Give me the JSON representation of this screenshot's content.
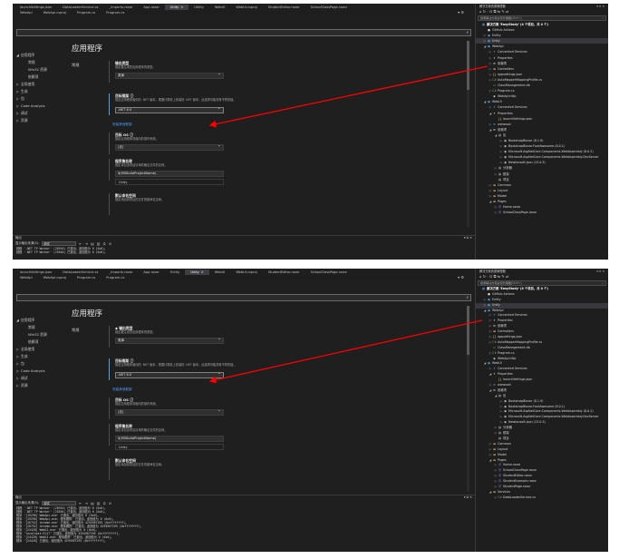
{
  "accent_color": "#ff0000",
  "highlight_color": "#56a0e8",
  "screens": [
    {
      "tabs_row1": [
        {
          "label": "launchSettings.json",
          "active": false
        },
        {
          "label": "DataLoaderService.cs",
          "active": false
        },
        {
          "label": "_Imports.razor",
          "active": false
        },
        {
          "label": "App.razor",
          "active": false
        },
        {
          "label": "Unity",
          "active": true,
          "close": "✕"
        },
        {
          "label": "Utility",
          "active": false
        },
        {
          "label": "WebUI",
          "active": false
        },
        {
          "label": "WebUI.csproj",
          "active": false
        },
        {
          "label": "StudentEditor.razor",
          "active": false
        },
        {
          "label": "SchoolClassPage.razor",
          "active": false
        }
      ],
      "tabs_row2": [
        {
          "label": "WebApi",
          "active": false
        },
        {
          "label": "WebApi.csproj",
          "active": false
        },
        {
          "label": "Program.cs",
          "active": false
        },
        {
          "label": "Program.cs",
          "active": false
        }
      ],
      "tab_controls": "▾ ⚙",
      "search": {
        "placeholder": "",
        "icon": "⌕"
      },
      "nav": [
        {
          "label": "应用程序",
          "caret": "◢",
          "sub": false
        },
        {
          "label": "常规",
          "caret": "",
          "sub": true
        },
        {
          "label": "Win32 资源",
          "caret": "",
          "sub": true
        },
        {
          "label": "依赖项",
          "caret": "",
          "sub": true
        },
        {
          "label": "全局使用",
          "caret": "▷",
          "sub": false
        },
        {
          "label": "生成",
          "caret": "▷",
          "sub": false
        },
        {
          "label": "包",
          "caret": "▷",
          "sub": false
        },
        {
          "label": "Code Analysis",
          "caret": "▷",
          "sub": false
        },
        {
          "label": "调试",
          "caret": "▷",
          "sub": false
        },
        {
          "label": "资源",
          "caret": "▷",
          "sub": false
        }
      ],
      "page_title": "应用程序",
      "section_title": "常规",
      "fields": {
        "output_type_label": "输出类型",
        "output_type_desc": "指定要生成的应用程序的类型。",
        "output_type_value": "类库",
        "target_fw_label": "目标框架 ⓘ",
        "target_fw_desc": "指定应用程序面向的 .NET 版本。根据计算机上安装的 .NET 版本，此选项可能具有不同的值。",
        "target_fw_value": ".NET 6.0",
        "install_link": "安装其他框架",
        "target_os_label": "目标 OS ⓘ",
        "target_os_desc": "指定应用程序将面向的操作系统。",
        "target_os_value": "(无)",
        "assembly_label": "程序集名称",
        "assembly_desc": "指定将包含项目清单的输出文件的名称。",
        "assembly_value": "$(MSBuildProjectName)",
        "assembly_resolved": "Unity",
        "namespace_label": "默认命名空间",
        "namespace_desc": "指定添加到项目的文件的基命名空间。"
      },
      "output": {
        "title": "输出",
        "controls": "▾ ⧉ ✕",
        "show_from": "显示输出来源(S):",
        "source": "调试",
        "toolbar_icons": [
          "⇤",
          "⇥",
          "▤",
          "▥",
          "⛭",
          "⊘"
        ],
        "lines": [
          "线程 '.NET TP Worker' (26916) 已退出，返回值为 0 (0x0)。",
          "线程 '.NET TP Worker' (25564) 已退出，返回值为 0 (0x0)。"
        ]
      },
      "solution": {
        "title": "解决方案资源管理器",
        "controls": "▾ ⊓ ✕",
        "toolbar": "⌂ ↻ · ⊡ ⧉ ⇆ ✎ ⇌",
        "search_placeholder": "搜索解决方案资源管理器(Ctrl+;)",
        "search_icon": "⌕",
        "rows": [
          {
            "d": 0,
            "tw": "",
            "ic": "▦",
            "k": "proj",
            "t": "解决方案 'EasyStudy' (4 个项目，共 4 个)",
            "bold": true
          },
          {
            "d": 1,
            "tw": "",
            "ic": "●",
            "k": "gh",
            "t": "GitHub Actions"
          },
          {
            "d": 1,
            "tw": "▷",
            "ic": "▣",
            "k": "proj",
            "t": "Entity"
          },
          {
            "d": 1,
            "tw": "▷",
            "ic": "▣",
            "k": "proj",
            "t": "Unity",
            "sel": true
          },
          {
            "d": 1,
            "tw": "◢",
            "ic": "▣",
            "k": "proj",
            "t": "WebApi"
          },
          {
            "d": 2,
            "tw": "▷",
            "ic": "✦",
            "k": "conn",
            "t": "Connected Services"
          },
          {
            "d": 2,
            "tw": "▷",
            "ic": "✦",
            "k": "file",
            "t": "Properties"
          },
          {
            "d": 2,
            "tw": "▷",
            "ic": "⊞",
            "k": "pkg",
            "t": "依赖项"
          },
          {
            "d": 2,
            "tw": "▷",
            "ic": "▬",
            "k": "fold",
            "t": "Controllers"
          },
          {
            "d": 2,
            "tw": "▷",
            "ic": "{}",
            "k": "json",
            "t": "appsettings.json"
          },
          {
            "d": 2,
            "tw": "▷",
            "ic": "C#",
            "k": "cs",
            "t": "AutoMapperMappingProfile.cs"
          },
          {
            "d": 2,
            "tw": "",
            "ic": "▭",
            "k": "file",
            "t": "ClassManagement.db"
          },
          {
            "d": 2,
            "tw": "▷",
            "ic": "C#",
            "k": "cs",
            "t": "Program.cs"
          },
          {
            "d": 2,
            "tw": "",
            "ic": "◆",
            "k": "file",
            "t": "WebApi.http"
          },
          {
            "d": 1,
            "tw": "◢",
            "ic": "▣",
            "k": "proj",
            "t": "WebUI"
          },
          {
            "d": 2,
            "tw": "▷",
            "ic": "✦",
            "k": "conn",
            "t": "Connected Services"
          },
          {
            "d": 2,
            "tw": "◢",
            "ic": "✦",
            "k": "file",
            "t": "Properties"
          },
          {
            "d": 3,
            "tw": "",
            "ic": "{}",
            "k": "json",
            "t": "launchSettings.json"
          },
          {
            "d": 2,
            "tw": "▷",
            "ic": "⊕",
            "k": "proj",
            "t": "wwwroot"
          },
          {
            "d": 2,
            "tw": "◢",
            "ic": "⊞",
            "k": "pkg",
            "t": "依赖项"
          },
          {
            "d": 3,
            "tw": "◢",
            "ic": "▤",
            "k": "pkg",
            "t": "包"
          },
          {
            "d": 4,
            "tw": "▷",
            "ic": "◉",
            "k": "pkg",
            "t": "BootstrapBlazor (8.1.9)"
          },
          {
            "d": 4,
            "tw": "▷",
            "ic": "◉",
            "k": "pkg",
            "t": "BootstrapBlazor.FontAwesome (8.0.1)"
          },
          {
            "d": 4,
            "tw": "▷",
            "ic": "◉",
            "k": "pkg",
            "t": "Microsoft.AspNetCore.Components.WebAssembly (8.0.2)"
          },
          {
            "d": 4,
            "tw": "▷",
            "ic": "◉",
            "k": "pkg",
            "t": "Microsoft.AspNetCore.Components.WebAssembly.DevServer"
          },
          {
            "d": 4,
            "tw": "▷",
            "ic": "◉",
            "k": "pkg",
            "t": "Newtonsoft.Json (13.0.3)"
          },
          {
            "d": 3,
            "tw": "▷",
            "ic": "▤",
            "k": "pkg",
            "t": "分析器"
          },
          {
            "d": 3,
            "tw": "▷",
            "ic": "▤",
            "k": "pkg",
            "t": "框架"
          },
          {
            "d": 3,
            "tw": "",
            "ic": "▤",
            "k": "pkg",
            "t": "项目"
          },
          {
            "d": 2,
            "tw": "▷",
            "ic": "▬",
            "k": "fold",
            "t": "Common"
          },
          {
            "d": 2,
            "tw": "▷",
            "ic": "▬",
            "k": "fold",
            "t": "Layout"
          },
          {
            "d": 2,
            "tw": "▷",
            "ic": "▬",
            "k": "fold",
            "t": "Model"
          },
          {
            "d": 2,
            "tw": "◢",
            "ic": "▬",
            "k": "fold",
            "t": "Pages"
          },
          {
            "d": 3,
            "tw": "▷",
            "ic": "@",
            "k": "razor",
            "t": "Home.razor"
          },
          {
            "d": 3,
            "tw": "▷",
            "ic": "@",
            "k": "razor",
            "t": "SchoolClassPage.razor"
          }
        ]
      }
    },
    {
      "tabs_row1": [
        {
          "label": "launchSettings.json",
          "active": false
        },
        {
          "label": "DataLoaderService.cs",
          "active": false
        },
        {
          "label": "_Imports.razor",
          "active": false
        },
        {
          "label": "App.razor",
          "active": false
        },
        {
          "label": "Entity",
          "active": false
        },
        {
          "label": "Unity",
          "active": true,
          "close": "✕"
        },
        {
          "label": "WebUI",
          "active": false
        },
        {
          "label": "WebUI.csproj",
          "active": false
        },
        {
          "label": "StudentEditor.razor",
          "active": false
        },
        {
          "label": "SchoolClassPage.razor",
          "active": false
        }
      ],
      "tabs_row2": [
        {
          "label": "WebApi",
          "active": false
        },
        {
          "label": "WebApi.csproj",
          "active": false
        },
        {
          "label": "Program.cs",
          "active": false
        },
        {
          "label": "Program.cs",
          "active": false
        }
      ],
      "tab_controls": "▾ ⚙",
      "search": {
        "placeholder": "",
        "icon": "⌕"
      },
      "nav": [
        {
          "label": "应用程序",
          "caret": "◢",
          "sub": false
        },
        {
          "label": "常规",
          "caret": "",
          "sub": true
        },
        {
          "label": "Win32 资源",
          "caret": "",
          "sub": true
        },
        {
          "label": "依赖项",
          "caret": "",
          "sub": true
        },
        {
          "label": "全局使用",
          "caret": "▷",
          "sub": false
        },
        {
          "label": "生成",
          "caret": "▷",
          "sub": false
        },
        {
          "label": "包",
          "caret": "▷",
          "sub": false
        },
        {
          "label": "Code Analysis",
          "caret": "▷",
          "sub": false
        },
        {
          "label": "调试",
          "caret": "▷",
          "sub": false
        },
        {
          "label": "资源",
          "caret": "▷",
          "sub": false
        }
      ],
      "page_title": "应用程序",
      "section_title": "常规",
      "fields": {
        "output_type_label": "◆ 输出类型",
        "output_type_desc": "指定要生成的应用程序的类型。",
        "output_type_value": "类库",
        "target_fw_label": "目标框架 ⓘ",
        "target_fw_desc": "指定应用程序面向的 .NET 版本。根据计算机上安装的 .NET 版本，此选项可能具有不同的值。",
        "target_fw_value": ".NET 6.0",
        "install_link": "安装其他框架",
        "target_os_label": "目标 OS ⓘ",
        "target_os_desc": "指定应用程序将面向的操作系统。",
        "target_os_value": "(无)",
        "assembly_label": "程序集名称",
        "assembly_desc": "指定将包含项目清单的输出文件的名称。",
        "assembly_value": "$(MSBuildProjectName)",
        "assembly_resolved": "Unity",
        "namespace_label": "默认命名空间",
        "namespace_desc": "指定添加到项目的文件的基命名空间。"
      },
      "output": {
        "title": "输出",
        "controls": "▾ ⧉ ✕",
        "show_from": "显示输出来源(S):",
        "source": "调试",
        "toolbar_icons": [
          "⇤",
          "⇥",
          "▤",
          "▥",
          "⛭",
          "⊘"
        ],
        "lines": [
          "线程 '.NET TP Worker' (26916) 已退出，返回值为 0 (0x0)。",
          "线程 '.NET TP Worker' (25564) 已退出，返回值为 0 (0x0)。",
          "程序 '[19296] WebApi.exe' 已退出，返回值为 0 (0x0)。",
          "程序 '[19296] WebApi.exe: 程序跟踪' 已退出，返回值为 0 (0x0)。",
          "程序 '[26752] chrome.exe' 已退出，返回值为 4294967295 (0xffffffff)。",
          "程序 '[26752] chrome.exe: 程序跟踪' 已退出，返回值为 4294967295 (0xffffffff)。",
          "程序 '[24428] WebUI.exe' 已退出，返回值为 0 (0x0)。",
          "程序 'localhost:5117' 已退出，返回值为 4294967295 (0xffffffff)。",
          "程序 '[24428] WebUI.exe: 程序跟踪' 已退出，返回值为 0 (0x0)。",
          "程序 '[24428] 已退出，返回值为 4294967295 (0xffffffff)。"
        ]
      },
      "solution": {
        "title": "解决方案资源管理器",
        "controls": "▾ ⊓ ✕",
        "toolbar": "⌂ ↻ · ⊡ ⧉ ⇆ ✎ ⇌",
        "search_placeholder": "搜索解决方案资源管理器(Ctrl+;)",
        "search_icon": "⌕",
        "rows": [
          {
            "d": 0,
            "tw": "",
            "ic": "▦",
            "k": "proj",
            "t": "解决方案 'EasyStudy' (4 个项目，共 4 个)",
            "bold": true
          },
          {
            "d": 1,
            "tw": "",
            "ic": "●",
            "k": "gh",
            "t": "GitHub Actions"
          },
          {
            "d": 1,
            "tw": "▷",
            "ic": "▣",
            "k": "proj",
            "t": "Entity"
          },
          {
            "d": 1,
            "tw": "▷",
            "ic": "▣",
            "k": "proj",
            "t": "Unity",
            "sel": true
          },
          {
            "d": 1,
            "tw": "◢",
            "ic": "▣",
            "k": "proj",
            "t": "WebApi"
          },
          {
            "d": 2,
            "tw": "▷",
            "ic": "✦",
            "k": "conn",
            "t": "Connected Services"
          },
          {
            "d": 2,
            "tw": "▷",
            "ic": "✦",
            "k": "file",
            "t": "Properties"
          },
          {
            "d": 2,
            "tw": "▷",
            "ic": "⊞",
            "k": "pkg",
            "t": "依赖项"
          },
          {
            "d": 2,
            "tw": "▷",
            "ic": "▬",
            "k": "fold",
            "t": "Controllers"
          },
          {
            "d": 2,
            "tw": "▷",
            "ic": "{}",
            "k": "json",
            "t": "appsettings.json"
          },
          {
            "d": 2,
            "tw": "▷",
            "ic": "C#",
            "k": "cs",
            "t": "AutoMapperMappingProfile.cs"
          },
          {
            "d": 2,
            "tw": "",
            "ic": "▭",
            "k": "file",
            "t": "ClassManagement.db"
          },
          {
            "d": 2,
            "tw": "▷",
            "ic": "C#",
            "k": "cs",
            "t": "Program.cs"
          },
          {
            "d": 2,
            "tw": "",
            "ic": "◆",
            "k": "file",
            "t": "WebApi.http"
          },
          {
            "d": 1,
            "tw": "◢",
            "ic": "▣",
            "k": "proj",
            "t": "WebUI"
          },
          {
            "d": 2,
            "tw": "▷",
            "ic": "✦",
            "k": "conn",
            "t": "Connected Services"
          },
          {
            "d": 2,
            "tw": "◢",
            "ic": "✦",
            "k": "file",
            "t": "Properties"
          },
          {
            "d": 3,
            "tw": "",
            "ic": "{}",
            "k": "json",
            "t": "launchSettings.json"
          },
          {
            "d": 2,
            "tw": "▷",
            "ic": "⊕",
            "k": "proj",
            "t": "wwwroot"
          },
          {
            "d": 2,
            "tw": "◢",
            "ic": "⊞",
            "k": "pkg",
            "t": "依赖项"
          },
          {
            "d": 3,
            "tw": "◢",
            "ic": "▤",
            "k": "pkg",
            "t": "包"
          },
          {
            "d": 4,
            "tw": "▷",
            "ic": "◉",
            "k": "pkg",
            "t": "BootstrapBlazor (8.1.9)"
          },
          {
            "d": 4,
            "tw": "▷",
            "ic": "◉",
            "k": "pkg",
            "t": "BootstrapBlazor.FontAwesome (8.0.1)"
          },
          {
            "d": 4,
            "tw": "▷",
            "ic": "◉",
            "k": "pkg",
            "t": "Microsoft.AspNetCore.Components.WebAssembly (8.0.2)"
          },
          {
            "d": 4,
            "tw": "▷",
            "ic": "◉",
            "k": "pkg",
            "t": "Microsoft.AspNetCore.Components.WebAssembly.DevServer"
          },
          {
            "d": 4,
            "tw": "▷",
            "ic": "◉",
            "k": "pkg",
            "t": "Newtonsoft.Json (13.0.3)"
          },
          {
            "d": 3,
            "tw": "▷",
            "ic": "▤",
            "k": "pkg",
            "t": "分析器"
          },
          {
            "d": 3,
            "tw": "▷",
            "ic": "▤",
            "k": "pkg",
            "t": "框架"
          },
          {
            "d": 3,
            "tw": "",
            "ic": "▤",
            "k": "pkg",
            "t": "项目"
          },
          {
            "d": 2,
            "tw": "▷",
            "ic": "▬",
            "k": "fold",
            "t": "Common"
          },
          {
            "d": 2,
            "tw": "▷",
            "ic": "▬",
            "k": "fold",
            "t": "Layout"
          },
          {
            "d": 2,
            "tw": "▷",
            "ic": "▬",
            "k": "fold",
            "t": "Model"
          },
          {
            "d": 2,
            "tw": "◢",
            "ic": "▬",
            "k": "fold",
            "t": "Pages"
          },
          {
            "d": 3,
            "tw": "▷",
            "ic": "@",
            "k": "razor",
            "t": "Home.razor"
          },
          {
            "d": 3,
            "tw": "▷",
            "ic": "@",
            "k": "razor",
            "t": "SchoolClassPage.razor"
          },
          {
            "d": 3,
            "tw": "▷",
            "ic": "@",
            "k": "razor",
            "t": "StudentEditor.razor"
          },
          {
            "d": 3,
            "tw": "▷",
            "ic": "@",
            "k": "razor",
            "t": "StudentExample.razor"
          },
          {
            "d": 3,
            "tw": "▷",
            "ic": "@",
            "k": "razor",
            "t": "StudentPage.razor"
          },
          {
            "d": 2,
            "tw": "◢",
            "ic": "▬",
            "k": "fold",
            "t": "Services"
          },
          {
            "d": 3,
            "tw": "▷",
            "ic": "C#",
            "k": "cs",
            "t": "DataLoaderService.cs"
          }
        ]
      }
    }
  ]
}
